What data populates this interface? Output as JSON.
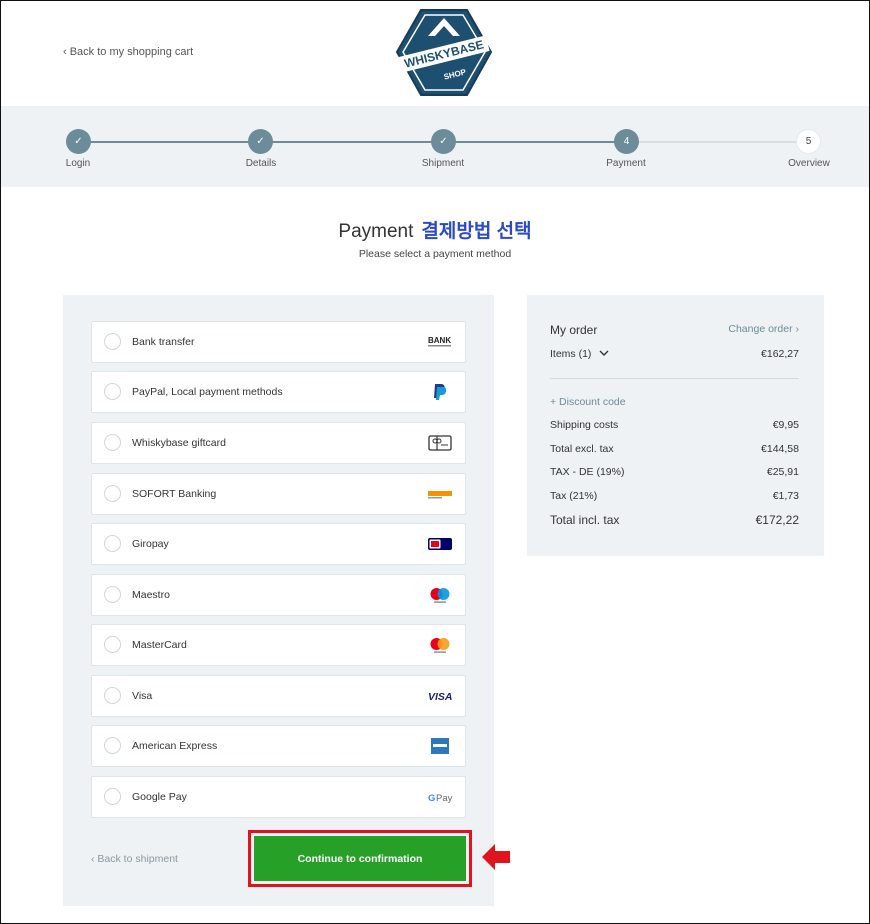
{
  "header": {
    "back_link": "‹ Back to my shopping cart",
    "logo_text": "WHISKYBASE",
    "logo_sub": "SHOP"
  },
  "steps": [
    {
      "label": "Login",
      "num": "✓",
      "state": "done"
    },
    {
      "label": "Details",
      "num": "✓",
      "state": "done"
    },
    {
      "label": "Shipment",
      "num": "✓",
      "state": "done"
    },
    {
      "label": "Payment",
      "num": "4",
      "state": "current"
    },
    {
      "label": "Overview",
      "num": "5",
      "state": "pending"
    }
  ],
  "page": {
    "title": "Payment",
    "title_annotation": "결제방법 선택",
    "subtitle": "Please select a payment method"
  },
  "methods": [
    {
      "label": "Bank transfer",
      "icon": "bank-icon"
    },
    {
      "label": "PayPal, Local payment methods",
      "icon": "paypal-icon"
    },
    {
      "label": "Whiskybase giftcard",
      "icon": "giftcard-icon"
    },
    {
      "label": "SOFORT Banking",
      "icon": "sofort-icon"
    },
    {
      "label": "Giropay",
      "icon": "giropay-icon"
    },
    {
      "label": "Maestro",
      "icon": "maestro-icon"
    },
    {
      "label": "MasterCard",
      "icon": "mastercard-icon"
    },
    {
      "label": "Visa",
      "icon": "visa-icon"
    },
    {
      "label": "American Express",
      "icon": "amex-icon"
    },
    {
      "label": "Google Pay",
      "icon": "googlepay-icon"
    }
  ],
  "actions": {
    "back_shipment": "‹ Back to shipment",
    "continue": "Continue to confirmation"
  },
  "summary": {
    "title": "My order",
    "change_order": "Change order ›",
    "items_label": "Items (1)",
    "items_value": "€162,27",
    "discount": "+ Discount code",
    "rows": [
      {
        "label": "Shipping costs",
        "value": "€9,95"
      },
      {
        "label": "Total excl. tax",
        "value": "€144,58"
      },
      {
        "label": "TAX - DE (19%)",
        "value": "€25,91"
      },
      {
        "label": "Tax (21%)",
        "value": "€1,73"
      }
    ],
    "total_label": "Total incl. tax",
    "total_value": "€172,22"
  },
  "colors": {
    "accent": "#6c8c99",
    "cta": "#27a027",
    "highlight": "#e1141e",
    "annotation": "#2b49c8"
  }
}
